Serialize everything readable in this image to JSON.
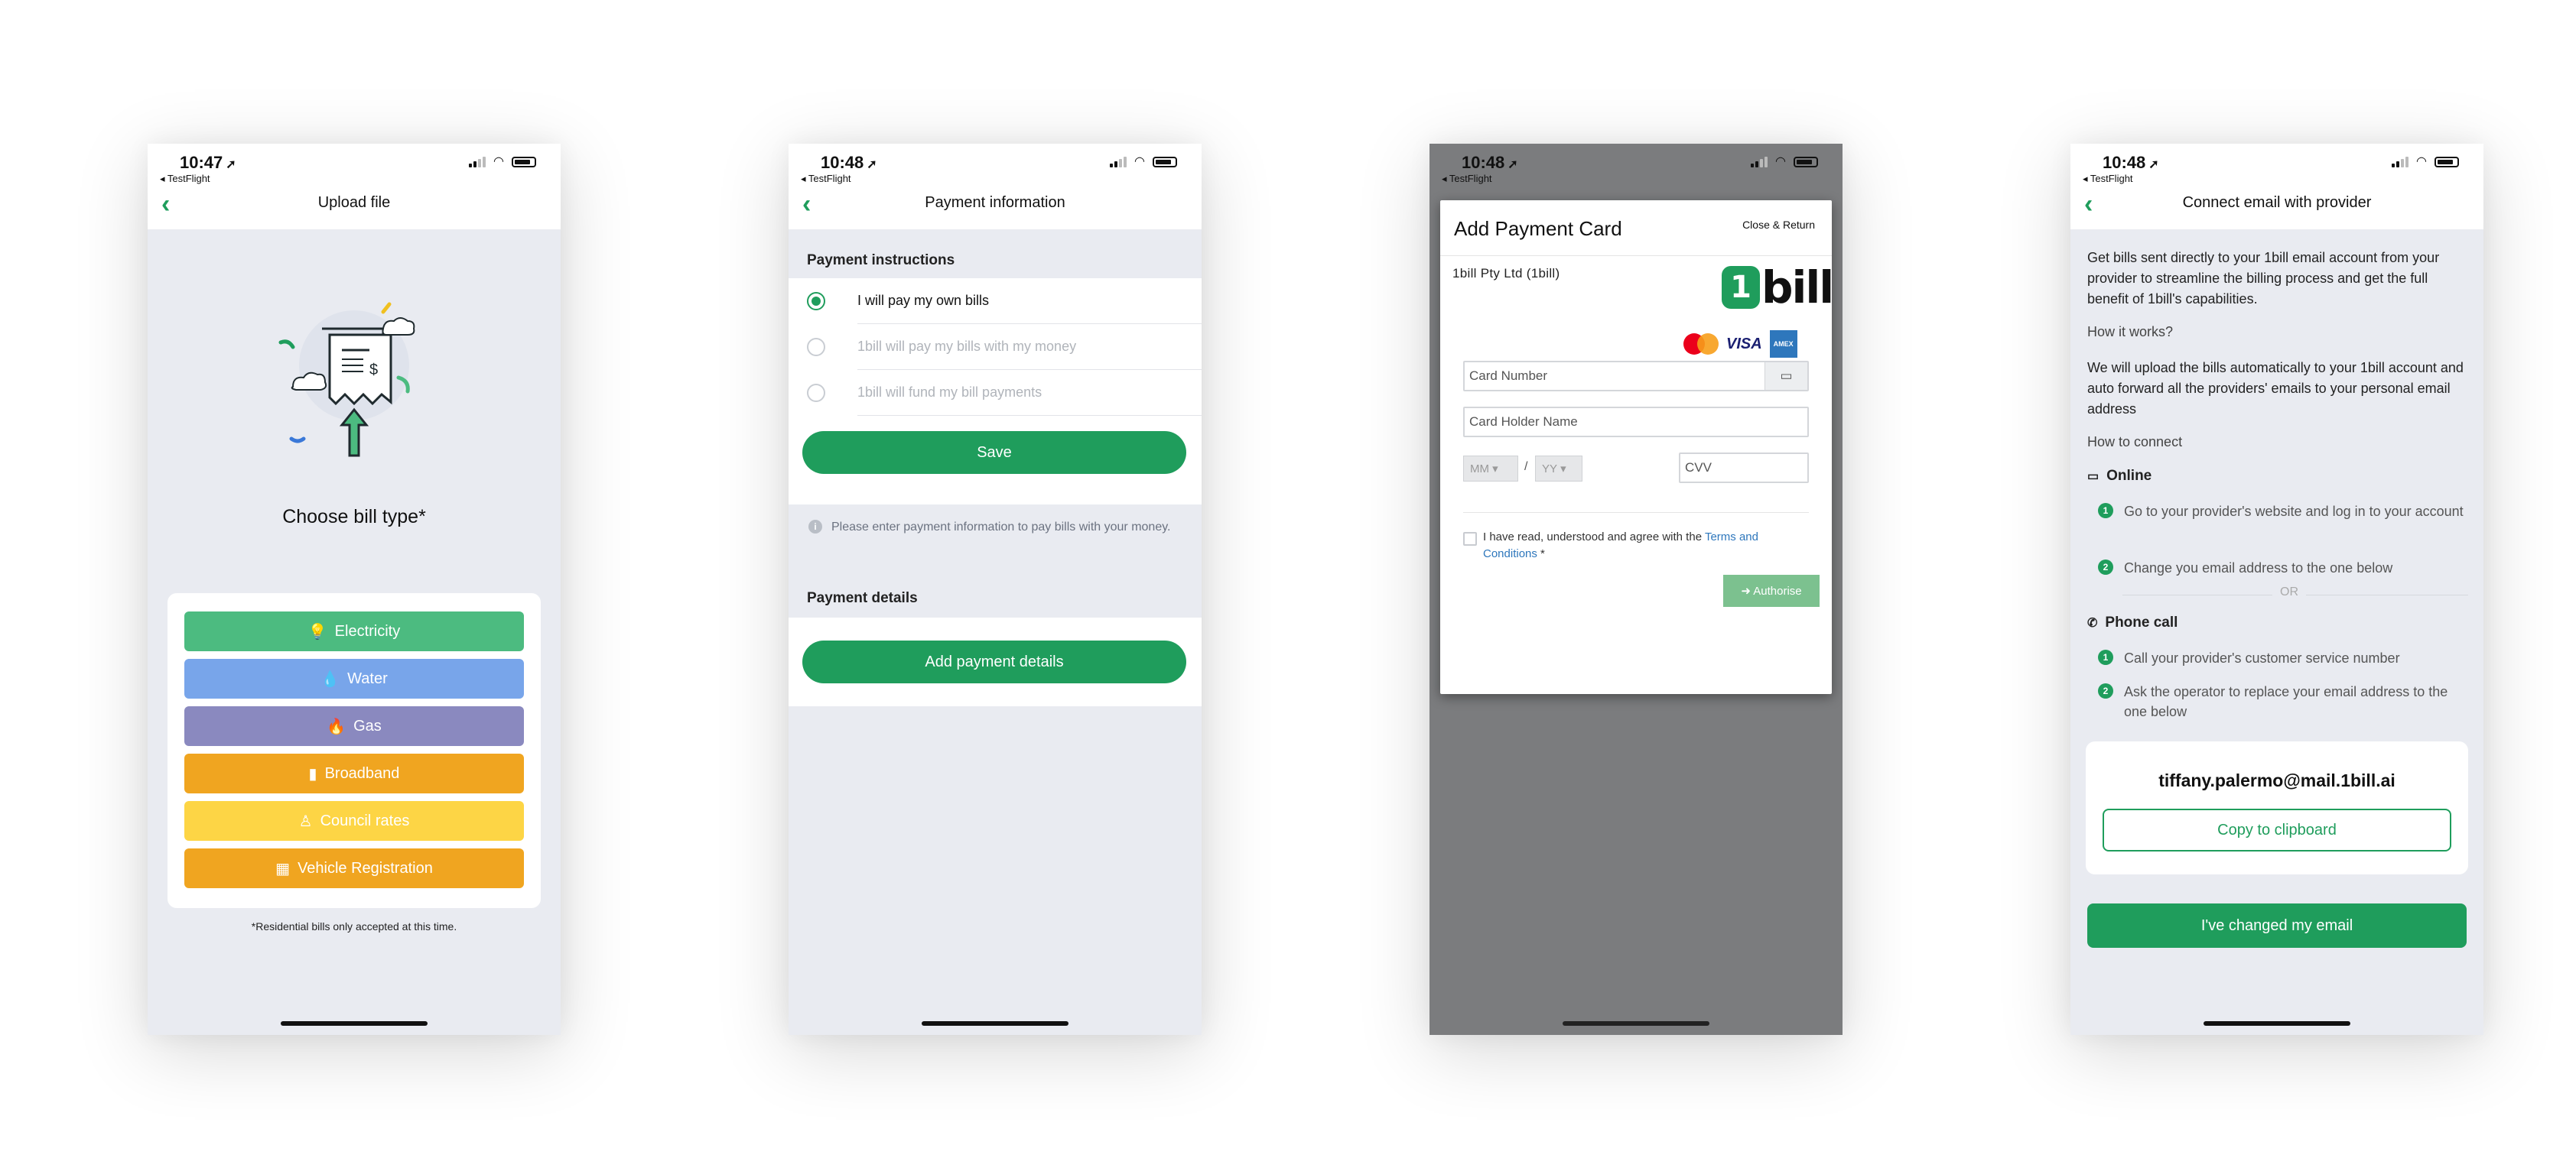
{
  "status_bar": {
    "testflight": "◂ TestFlight"
  },
  "screen1": {
    "time": "10:47",
    "title": "Upload file",
    "choose_label": "Choose bill type*",
    "bill_types": [
      "Electricity",
      "Water",
      "Gas",
      "Broadband",
      "Council rates",
      "Vehicle Registration"
    ],
    "bill_colors": [
      "#4cbb80",
      "#78a5ea",
      "#8a89bf",
      "#f0a520",
      "#fdd545",
      "#f0a520"
    ],
    "note": "*Residential bills only accepted at this time."
  },
  "screen2": {
    "time": "10:48",
    "title": "Payment information",
    "instructions_heading": "Payment instructions",
    "options": [
      "I will pay my own bills",
      "1bill will pay my bills with my money",
      "1bill will fund my bill payments"
    ],
    "save_label": "Save",
    "info_text": "Please enter payment information to pay bills with your money.",
    "details_heading": "Payment details",
    "add_details_label": "Add payment details"
  },
  "screen3": {
    "time": "10:48",
    "modal_title": "Add Payment Card",
    "close_label": "Close & Return",
    "company": "1bill Pty Ltd (1bill)",
    "logo_text": "bill",
    "card_number_placeholder": "Card Number",
    "holder_placeholder": "Card Holder Name",
    "month_placeholder": "MM",
    "year_placeholder": "YY",
    "slash": "/",
    "cvv_placeholder": "CVV",
    "terms_prefix": "I have read, understood and agree with the ",
    "terms_link": "Terms and Conditions",
    "terms_suffix": " *",
    "authorise_label": "➜ Authorise",
    "visa": "VISA",
    "amex": "AMEX"
  },
  "screen4": {
    "time": "10:48",
    "title": "Connect email with provider",
    "intro": "Get bills sent directly to your 1bill email account from your provider to streamline the billing process and get the full benefit of 1bill's capabilities.",
    "how_works": "How it works?",
    "upload_text": "We will upload the bills automatically to your 1bill account and auto forward all the providers' emails to your personal email address",
    "how_connect": "How to connect",
    "online_heading": "Online",
    "online_steps": [
      "Go to your provider's website and log in to your account",
      "Change you email address to the one below"
    ],
    "or_text": "OR",
    "phone_heading": "Phone call",
    "phone_steps": [
      "Call your provider's customer service number",
      "Ask the operator to replace your email address to the one below"
    ],
    "email": "tiffany.palermo@mail.1bill.ai",
    "copy_label": "Copy to clipboard",
    "changed_label": "I've changed my email"
  }
}
